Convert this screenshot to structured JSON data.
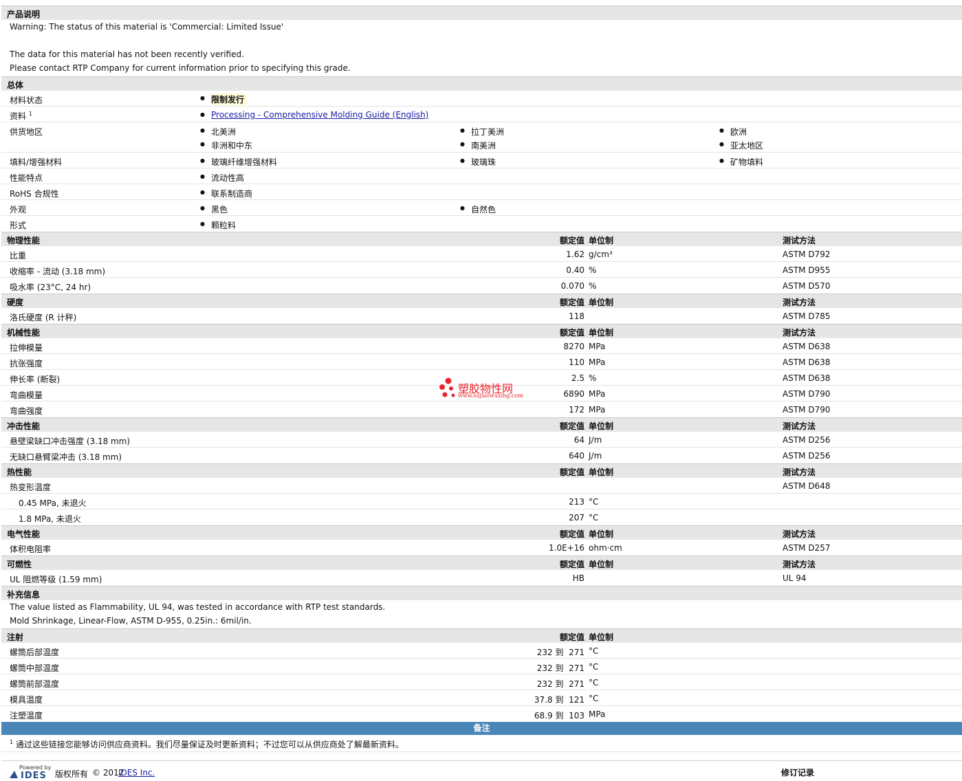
{
  "product_desc": {
    "title": "产品说明",
    "lines": [
      "Warning: The status of this material is 'Commercial: Limited Issue'",
      "",
      "The data for this material has not been recently verified.",
      "Please contact RTP Company for current information prior to specifying this grade."
    ]
  },
  "general": {
    "title": "总体",
    "material_status_label": "材料状态",
    "material_status_value": "限制发行",
    "resources_label": "资料",
    "resources_sup": "1",
    "resources_link": "Processing - Comprehensive Molding Guide (English)",
    "regions_label": "供货地区",
    "regions": [
      "北美洲",
      "拉丁美洲",
      "欧洲",
      "非洲和中东",
      "南美洲",
      "亚太地区"
    ],
    "fillers_label": "填料/增强材料",
    "fillers": [
      "玻璃纤维增强材料",
      "玻璃珠",
      "矿物填料"
    ],
    "features_label": "性能特点",
    "features": [
      "流动性高"
    ],
    "rohs_label": "RoHS 合规性",
    "rohs": [
      "联系制造商"
    ],
    "appearance_label": "外观",
    "appearance": [
      "黑色",
      "自然色"
    ],
    "form_label": "形式",
    "form": [
      "颗粒料"
    ]
  },
  "headers": {
    "value": "额定值",
    "unit": "单位制",
    "method": "测试方法"
  },
  "physical": {
    "title": "物理性能",
    "rows": [
      {
        "label": "比重",
        "value": "1.62",
        "unit": "g/cm³",
        "method": "ASTM D792"
      },
      {
        "label": "收缩率 - 流动 (3.18 mm)",
        "value": "0.40",
        "unit": "%",
        "method": "ASTM D955"
      },
      {
        "label": "吸水率 (23°C, 24 hr)",
        "value": "0.070",
        "unit": "%",
        "method": "ASTM D570"
      }
    ]
  },
  "hardness": {
    "title": "硬度",
    "rows": [
      {
        "label": "洛氏硬度 (R 计秤)",
        "value": "118",
        "unit": "",
        "method": "ASTM D785"
      }
    ]
  },
  "mechanical": {
    "title": "机械性能",
    "rows": [
      {
        "label": "拉伸模量",
        "value": "8270",
        "unit": "MPa",
        "method": "ASTM D638"
      },
      {
        "label": "抗张强度",
        "value": "110",
        "unit": "MPa",
        "method": "ASTM D638"
      },
      {
        "label": "伸长率 (断裂)",
        "value": "2.5",
        "unit": "%",
        "method": "ASTM D638"
      },
      {
        "label": "弯曲模量",
        "value": "6890",
        "unit": "MPa",
        "method": "ASTM D790"
      },
      {
        "label": "弯曲强度",
        "value": "172",
        "unit": "MPa",
        "method": "ASTM D790"
      }
    ]
  },
  "impact": {
    "title": "冲击性能",
    "rows": [
      {
        "label": "悬壁梁缺口冲击强度 (3.18 mm)",
        "value": "64",
        "unit": "J/m",
        "method": "ASTM D256"
      },
      {
        "label": "无缺口悬臂梁冲击 (3.18 mm)",
        "value": "640",
        "unit": "J/m",
        "method": "ASTM D256"
      }
    ]
  },
  "thermal": {
    "title": "热性能",
    "rows": [
      {
        "label": "热变形温度",
        "value": "",
        "unit": "",
        "method": "ASTM D648"
      },
      {
        "label": "0.45 MPa, 未退火",
        "value": "213",
        "unit": "°C",
        "method": ""
      },
      {
        "label": "1.8 MPa, 未退火",
        "value": "207",
        "unit": "°C",
        "method": ""
      }
    ]
  },
  "electrical": {
    "title": "电气性能",
    "rows": [
      {
        "label": "体积电阻率",
        "value": "1.0E+16",
        "unit": "ohm·cm",
        "method": "ASTM D257"
      }
    ]
  },
  "flammability": {
    "title": "可燃性",
    "rows": [
      {
        "label": "UL 阻燃等级 (1.59 mm)",
        "value": "HB",
        "unit": "",
        "method": "UL 94"
      }
    ]
  },
  "supplement": {
    "title": "补充信息",
    "lines": [
      "The value listed as Flammability, UL 94, was tested in accordance with RTP test standards.",
      "Mold Shrinkage, Linear-Flow, ASTM D-955, 0.25in.: 6mil/in."
    ]
  },
  "injection": {
    "title": "注射",
    "rows": [
      {
        "label": "螺筒后部温度",
        "value": "232 到  271",
        "unit": "°C"
      },
      {
        "label": "螺筒中部温度",
        "value": "232 到  271",
        "unit": "°C"
      },
      {
        "label": "螺筒前部温度",
        "value": "232 到  271",
        "unit": "°C"
      },
      {
        "label": "模具温度",
        "value": "37.8 到  121",
        "unit": "°C"
      },
      {
        "label": "注塑温度",
        "value": "68.9 到  103",
        "unit": "MPa"
      }
    ]
  },
  "notes": {
    "title": "备注",
    "sup": "1",
    "text": "通过这些链接您能够访问供应商资料。我们尽量保证及时更新资料；不过您可以从供应商处了解最新资料。"
  },
  "watermark": {
    "name": "塑胶物性网",
    "url": "www.sujiaowuxing.com"
  },
  "footer": {
    "powered_by": "Powered by",
    "logo": "IDES",
    "copyright_label": "版权所有",
    "copyright": "© 2012",
    "company_link": "IDES Inc.",
    "revision": "修订记录"
  }
}
